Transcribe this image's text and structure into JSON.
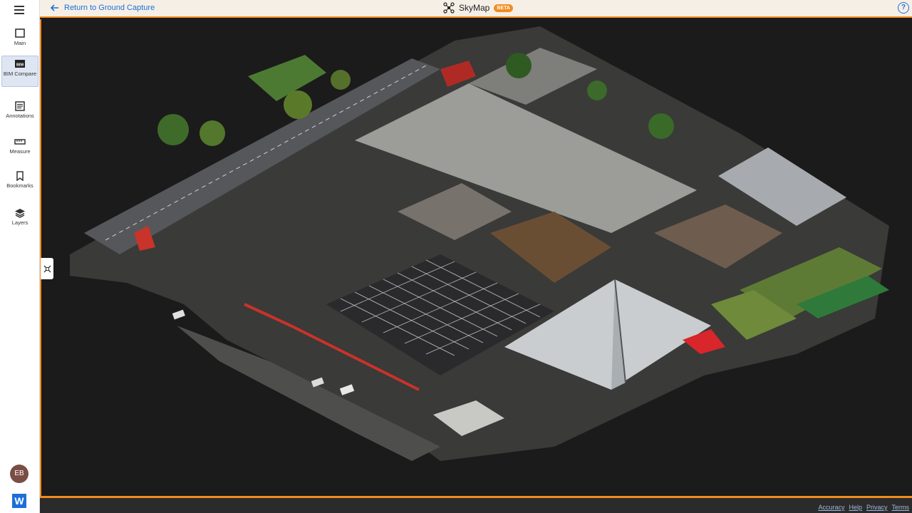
{
  "header": {
    "back_label": "Return to Ground Capture",
    "title": "SkyMap",
    "badge": "BETA",
    "help_label": "?"
  },
  "sidebar": {
    "items": [
      {
        "label": "Main",
        "icon": "square-icon"
      },
      {
        "label": "BIM Compare",
        "icon": "bim-icon",
        "active": true
      },
      {
        "label": "Annotations",
        "icon": "list-icon"
      },
      {
        "label": "Measure",
        "icon": "ruler-icon"
      },
      {
        "label": "Bookmarks",
        "icon": "bookmark-icon"
      },
      {
        "label": "Layers",
        "icon": "layers-icon"
      }
    ],
    "avatar": "EB",
    "logo": "W"
  },
  "footer": {
    "links": [
      "Accuracy",
      "Help",
      "Privacy",
      "Terms"
    ]
  },
  "colors": {
    "accent": "#f28c1f",
    "link": "#1d6fd6",
    "active_bg": "#dfe6f3"
  }
}
